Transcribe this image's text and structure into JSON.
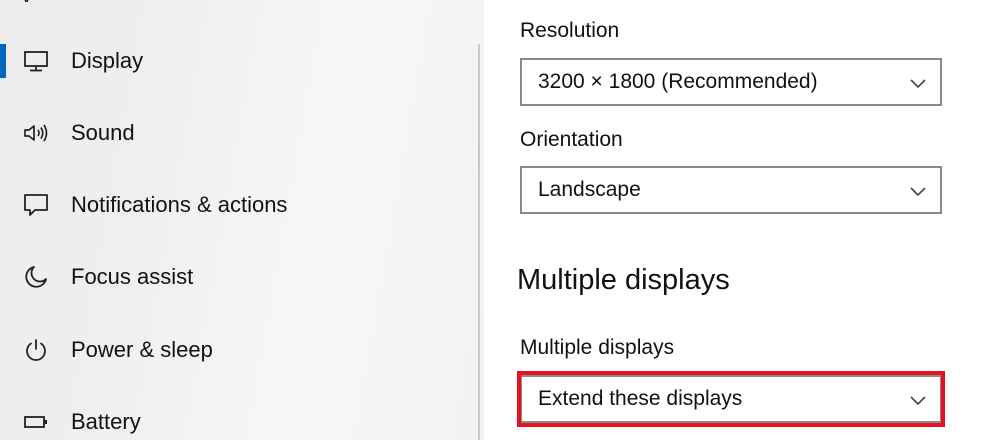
{
  "sidebar": {
    "items": [
      {
        "label": "Display",
        "icon": "monitor-icon",
        "selected": true
      },
      {
        "label": "Sound",
        "icon": "speaker-icon",
        "selected": false
      },
      {
        "label": "Notifications & actions",
        "icon": "message-icon",
        "selected": false
      },
      {
        "label": "Focus assist",
        "icon": "moon-icon",
        "selected": false
      },
      {
        "label": "Power & sleep",
        "icon": "power-icon",
        "selected": false
      },
      {
        "label": "Battery",
        "icon": "battery-icon",
        "selected": false
      }
    ]
  },
  "content": {
    "resolution": {
      "label": "Resolution",
      "value": "3200 × 1800 (Recommended)"
    },
    "orientation": {
      "label": "Orientation",
      "value": "Landscape"
    },
    "multiple_displays_section": {
      "title": "Multiple displays",
      "label": "Multiple displays",
      "value": "Extend these displays"
    }
  },
  "colors": {
    "accent": "#0067c0",
    "highlight": "#e81123",
    "dropdown_border": "#8a8a8a",
    "sidebar_bg": "#efefef"
  }
}
